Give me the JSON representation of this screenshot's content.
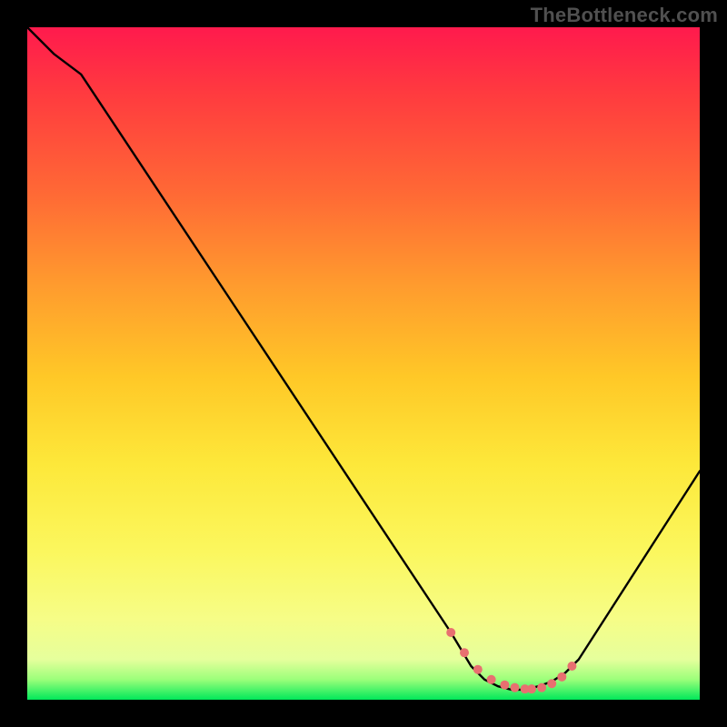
{
  "watermark": "TheBottleneck.com",
  "chart_data": {
    "type": "line",
    "title": "",
    "xlabel": "",
    "ylabel": "",
    "xlim": [
      0,
      100
    ],
    "ylim": [
      0,
      100
    ],
    "series": [
      {
        "name": "bottleneck-curve",
        "color": "#000000",
        "x": [
          0,
          4,
          8,
          63,
          66,
          68,
          70,
          72,
          74,
          76,
          78,
          80,
          82,
          100
        ],
        "y": [
          100,
          96,
          93,
          10,
          5,
          3,
          2,
          1.5,
          1.5,
          2,
          2.7,
          4,
          6,
          34
        ]
      },
      {
        "name": "optimal-range-markers",
        "color": "#e87070",
        "style": "dots",
        "x": [
          63,
          65,
          67,
          69,
          71,
          72.5,
          74,
          75,
          76.5,
          78,
          79.5,
          81
        ],
        "y": [
          10,
          7,
          4.5,
          3,
          2.2,
          1.8,
          1.6,
          1.6,
          1.8,
          2.4,
          3.4,
          5
        ]
      }
    ],
    "gradient_stops": [
      {
        "pos": 0,
        "color": "#ff1a4d"
      },
      {
        "pos": 10,
        "color": "#ff3b3f"
      },
      {
        "pos": 25,
        "color": "#ff6a35"
      },
      {
        "pos": 38,
        "color": "#ff9a2e"
      },
      {
        "pos": 52,
        "color": "#ffc827"
      },
      {
        "pos": 65,
        "color": "#fde83a"
      },
      {
        "pos": 78,
        "color": "#fbf75e"
      },
      {
        "pos": 88,
        "color": "#f6fd87"
      },
      {
        "pos": 94,
        "color": "#e6ff9c"
      },
      {
        "pos": 97,
        "color": "#9bff7a"
      },
      {
        "pos": 100,
        "color": "#00e85a"
      }
    ]
  }
}
